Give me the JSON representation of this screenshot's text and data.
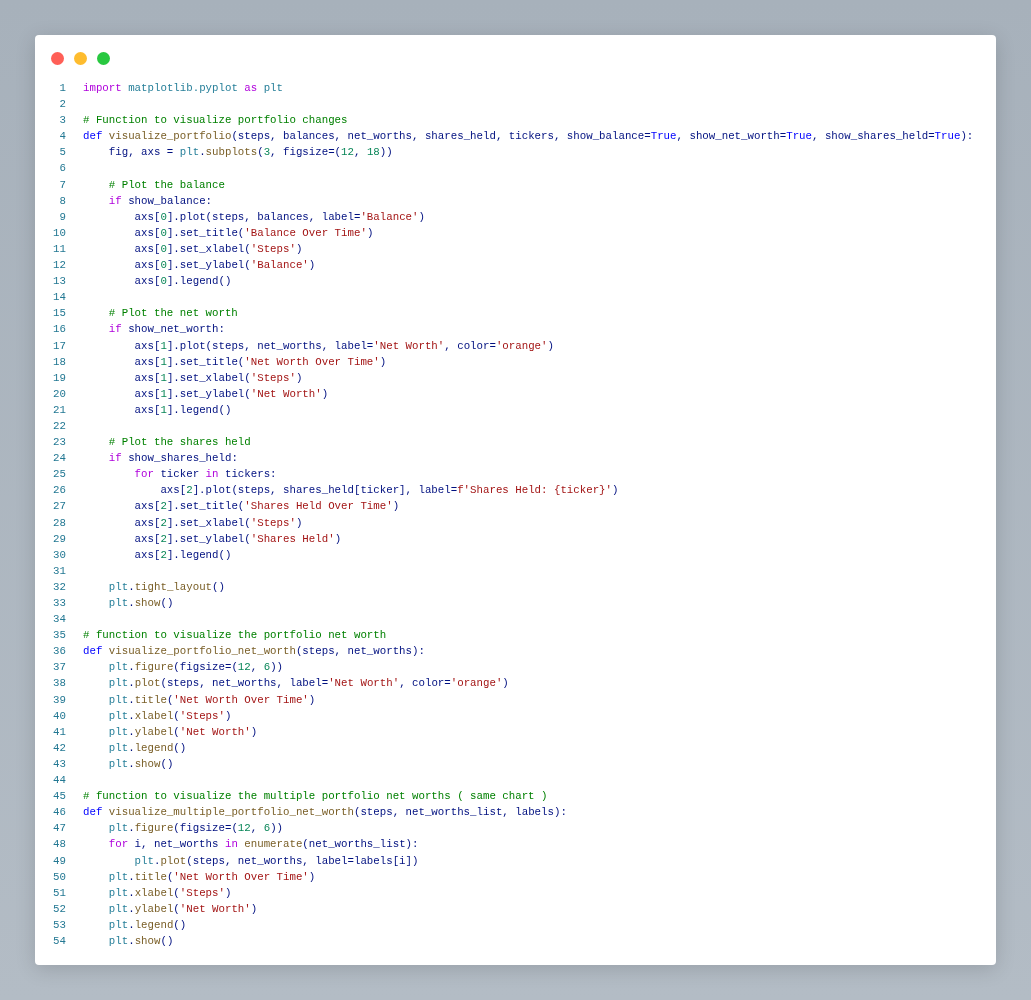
{
  "code": {
    "lines": [
      {
        "number": "1",
        "tokens": [
          {
            "kind": "keyword",
            "text": "import "
          },
          {
            "kind": "module",
            "text": "matplotlib.pyplot "
          },
          {
            "kind": "keyword",
            "text": "as "
          },
          {
            "kind": "module",
            "text": "plt"
          }
        ]
      },
      {
        "number": "2"
      },
      {
        "number": "3",
        "tokens": [
          {
            "kind": "comment",
            "text": "# Function to visualize portfolio changes"
          }
        ]
      },
      {
        "number": "4",
        "tokens": [
          {
            "kind": "def",
            "text": "def "
          },
          {
            "kind": "function",
            "text": "visualize_portfolio"
          },
          {
            "kind": "name",
            "text": "(steps, balances, net_worths, shares_held, tickers, show_balance="
          },
          {
            "kind": "constant",
            "text": "True"
          },
          {
            "kind": "name",
            "text": ", show_net_worth="
          },
          {
            "kind": "constant",
            "text": "True"
          },
          {
            "kind": "name",
            "text": ", show_shares_held="
          },
          {
            "kind": "constant",
            "text": "True"
          },
          {
            "kind": "name",
            "text": "):"
          }
        ]
      },
      {
        "number": "5",
        "tokens": [
          {
            "kind": "name",
            "text": "    fig, axs = "
          },
          {
            "kind": "module",
            "text": "plt"
          },
          {
            "kind": "name",
            "text": "."
          },
          {
            "kind": "function",
            "text": "subplots"
          },
          {
            "kind": "name",
            "text": "("
          },
          {
            "kind": "number",
            "text": "3"
          },
          {
            "kind": "name",
            "text": ", figsize=("
          },
          {
            "kind": "number",
            "text": "12"
          },
          {
            "kind": "name",
            "text": ", "
          },
          {
            "kind": "number",
            "text": "18"
          },
          {
            "kind": "name",
            "text": "))"
          }
        ]
      },
      {
        "number": "6"
      },
      {
        "number": "7",
        "tokens": [
          {
            "kind": "comment",
            "text": "    # Plot the balance"
          }
        ]
      },
      {
        "number": "8",
        "tokens": [
          {
            "kind": "keyword",
            "text": "    if "
          },
          {
            "kind": "name",
            "text": "show_balance:"
          }
        ]
      },
      {
        "number": "9",
        "tokens": [
          {
            "kind": "name",
            "text": "        axs["
          },
          {
            "kind": "number",
            "text": "0"
          },
          {
            "kind": "name",
            "text": "].plot(steps, balances, label="
          },
          {
            "kind": "string",
            "text": "'Balance'"
          },
          {
            "kind": "name",
            "text": ")"
          }
        ]
      },
      {
        "number": "10",
        "tokens": [
          {
            "kind": "name",
            "text": "        axs["
          },
          {
            "kind": "number",
            "text": "0"
          },
          {
            "kind": "name",
            "text": "].set_title("
          },
          {
            "kind": "string",
            "text": "'Balance Over Time'"
          },
          {
            "kind": "name",
            "text": ")"
          }
        ]
      },
      {
        "number": "11",
        "tokens": [
          {
            "kind": "name",
            "text": "        axs["
          },
          {
            "kind": "number",
            "text": "0"
          },
          {
            "kind": "name",
            "text": "].set_xlabel("
          },
          {
            "kind": "string",
            "text": "'Steps'"
          },
          {
            "kind": "name",
            "text": ")"
          }
        ]
      },
      {
        "number": "12",
        "tokens": [
          {
            "kind": "name",
            "text": "        axs["
          },
          {
            "kind": "number",
            "text": "0"
          },
          {
            "kind": "name",
            "text": "].set_ylabel("
          },
          {
            "kind": "string",
            "text": "'Balance'"
          },
          {
            "kind": "name",
            "text": ")"
          }
        ]
      },
      {
        "number": "13",
        "tokens": [
          {
            "kind": "name",
            "text": "        axs["
          },
          {
            "kind": "number",
            "text": "0"
          },
          {
            "kind": "name",
            "text": "].legend()"
          }
        ]
      },
      {
        "number": "14"
      },
      {
        "number": "15",
        "tokens": [
          {
            "kind": "comment",
            "text": "    # Plot the net worth"
          }
        ]
      },
      {
        "number": "16",
        "tokens": [
          {
            "kind": "keyword",
            "text": "    if "
          },
          {
            "kind": "name",
            "text": "show_net_worth:"
          }
        ]
      },
      {
        "number": "17",
        "tokens": [
          {
            "kind": "name",
            "text": "        axs["
          },
          {
            "kind": "number",
            "text": "1"
          },
          {
            "kind": "name",
            "text": "].plot(steps, net_worths, label="
          },
          {
            "kind": "string",
            "text": "'Net Worth'"
          },
          {
            "kind": "name",
            "text": ", color="
          },
          {
            "kind": "string",
            "text": "'orange'"
          },
          {
            "kind": "name",
            "text": ")"
          }
        ]
      },
      {
        "number": "18",
        "tokens": [
          {
            "kind": "name",
            "text": "        axs["
          },
          {
            "kind": "number",
            "text": "1"
          },
          {
            "kind": "name",
            "text": "].set_title("
          },
          {
            "kind": "string",
            "text": "'Net Worth Over Time'"
          },
          {
            "kind": "name",
            "text": ")"
          }
        ]
      },
      {
        "number": "19",
        "tokens": [
          {
            "kind": "name",
            "text": "        axs["
          },
          {
            "kind": "number",
            "text": "1"
          },
          {
            "kind": "name",
            "text": "].set_xlabel("
          },
          {
            "kind": "string",
            "text": "'Steps'"
          },
          {
            "kind": "name",
            "text": ")"
          }
        ]
      },
      {
        "number": "20",
        "tokens": [
          {
            "kind": "name",
            "text": "        axs["
          },
          {
            "kind": "number",
            "text": "1"
          },
          {
            "kind": "name",
            "text": "].set_ylabel("
          },
          {
            "kind": "string",
            "text": "'Net Worth'"
          },
          {
            "kind": "name",
            "text": ")"
          }
        ]
      },
      {
        "number": "21",
        "tokens": [
          {
            "kind": "name",
            "text": "        axs["
          },
          {
            "kind": "number",
            "text": "1"
          },
          {
            "kind": "name",
            "text": "].legend()"
          }
        ]
      },
      {
        "number": "22"
      },
      {
        "number": "23",
        "tokens": [
          {
            "kind": "comment",
            "text": "    # Plot the shares held"
          }
        ]
      },
      {
        "number": "24",
        "tokens": [
          {
            "kind": "keyword",
            "text": "    if "
          },
          {
            "kind": "name",
            "text": "show_shares_held:"
          }
        ]
      },
      {
        "number": "25",
        "tokens": [
          {
            "kind": "keyword",
            "text": "        for "
          },
          {
            "kind": "name",
            "text": "ticker "
          },
          {
            "kind": "keyword",
            "text": "in "
          },
          {
            "kind": "name",
            "text": "tickers:"
          }
        ]
      },
      {
        "number": "26",
        "tokens": [
          {
            "kind": "name",
            "text": "            axs["
          },
          {
            "kind": "number",
            "text": "2"
          },
          {
            "kind": "name",
            "text": "].plot(steps, shares_held[ticker], label="
          },
          {
            "kind": "string",
            "text": "f'Shares Held: {ticker}'"
          },
          {
            "kind": "name",
            "text": ")"
          }
        ]
      },
      {
        "number": "27",
        "tokens": [
          {
            "kind": "name",
            "text": "        axs["
          },
          {
            "kind": "number",
            "text": "2"
          },
          {
            "kind": "name",
            "text": "].set_title("
          },
          {
            "kind": "string",
            "text": "'Shares Held Over Time'"
          },
          {
            "kind": "name",
            "text": ")"
          }
        ]
      },
      {
        "number": "28",
        "tokens": [
          {
            "kind": "name",
            "text": "        axs["
          },
          {
            "kind": "number",
            "text": "2"
          },
          {
            "kind": "name",
            "text": "].set_xlabel("
          },
          {
            "kind": "string",
            "text": "'Steps'"
          },
          {
            "kind": "name",
            "text": ")"
          }
        ]
      },
      {
        "number": "29",
        "tokens": [
          {
            "kind": "name",
            "text": "        axs["
          },
          {
            "kind": "number",
            "text": "2"
          },
          {
            "kind": "name",
            "text": "].set_ylabel("
          },
          {
            "kind": "string",
            "text": "'Shares Held'"
          },
          {
            "kind": "name",
            "text": ")"
          }
        ]
      },
      {
        "number": "30",
        "tokens": [
          {
            "kind": "name",
            "text": "        axs["
          },
          {
            "kind": "number",
            "text": "2"
          },
          {
            "kind": "name",
            "text": "].legend()"
          }
        ]
      },
      {
        "number": "31"
      },
      {
        "number": "32",
        "tokens": [
          {
            "kind": "module",
            "text": "    plt"
          },
          {
            "kind": "name",
            "text": "."
          },
          {
            "kind": "function",
            "text": "tight_layout"
          },
          {
            "kind": "name",
            "text": "()"
          }
        ]
      },
      {
        "number": "33",
        "tokens": [
          {
            "kind": "module",
            "text": "    plt"
          },
          {
            "kind": "name",
            "text": "."
          },
          {
            "kind": "function",
            "text": "show"
          },
          {
            "kind": "name",
            "text": "()"
          }
        ]
      },
      {
        "number": "34"
      },
      {
        "number": "35",
        "tokens": [
          {
            "kind": "comment",
            "text": "# function to visualize the portfolio net worth"
          }
        ]
      },
      {
        "number": "36",
        "tokens": [
          {
            "kind": "def",
            "text": "def "
          },
          {
            "kind": "function",
            "text": "visualize_portfolio_net_worth"
          },
          {
            "kind": "name",
            "text": "(steps, net_worths):"
          }
        ]
      },
      {
        "number": "37",
        "tokens": [
          {
            "kind": "module",
            "text": "    plt"
          },
          {
            "kind": "name",
            "text": "."
          },
          {
            "kind": "function",
            "text": "figure"
          },
          {
            "kind": "name",
            "text": "(figsize=("
          },
          {
            "kind": "number",
            "text": "12"
          },
          {
            "kind": "name",
            "text": ", "
          },
          {
            "kind": "number",
            "text": "6"
          },
          {
            "kind": "name",
            "text": "))"
          }
        ]
      },
      {
        "number": "38",
        "tokens": [
          {
            "kind": "module",
            "text": "    plt"
          },
          {
            "kind": "name",
            "text": "."
          },
          {
            "kind": "function",
            "text": "plot"
          },
          {
            "kind": "name",
            "text": "(steps, net_worths, label="
          },
          {
            "kind": "string",
            "text": "'Net Worth'"
          },
          {
            "kind": "name",
            "text": ", color="
          },
          {
            "kind": "string",
            "text": "'orange'"
          },
          {
            "kind": "name",
            "text": ")"
          }
        ]
      },
      {
        "number": "39",
        "tokens": [
          {
            "kind": "module",
            "text": "    plt"
          },
          {
            "kind": "name",
            "text": "."
          },
          {
            "kind": "function",
            "text": "title"
          },
          {
            "kind": "name",
            "text": "("
          },
          {
            "kind": "string",
            "text": "'Net Worth Over Time'"
          },
          {
            "kind": "name",
            "text": ")"
          }
        ]
      },
      {
        "number": "40",
        "tokens": [
          {
            "kind": "module",
            "text": "    plt"
          },
          {
            "kind": "name",
            "text": "."
          },
          {
            "kind": "function",
            "text": "xlabel"
          },
          {
            "kind": "name",
            "text": "("
          },
          {
            "kind": "string",
            "text": "'Steps'"
          },
          {
            "kind": "name",
            "text": ")"
          }
        ]
      },
      {
        "number": "41",
        "tokens": [
          {
            "kind": "module",
            "text": "    plt"
          },
          {
            "kind": "name",
            "text": "."
          },
          {
            "kind": "function",
            "text": "ylabel"
          },
          {
            "kind": "name",
            "text": "("
          },
          {
            "kind": "string",
            "text": "'Net Worth'"
          },
          {
            "kind": "name",
            "text": ")"
          }
        ]
      },
      {
        "number": "42",
        "tokens": [
          {
            "kind": "module",
            "text": "    plt"
          },
          {
            "kind": "name",
            "text": "."
          },
          {
            "kind": "function",
            "text": "legend"
          },
          {
            "kind": "name",
            "text": "()"
          }
        ]
      },
      {
        "number": "43",
        "tokens": [
          {
            "kind": "module",
            "text": "    plt"
          },
          {
            "kind": "name",
            "text": "."
          },
          {
            "kind": "function",
            "text": "show"
          },
          {
            "kind": "name",
            "text": "()"
          }
        ]
      },
      {
        "number": "44"
      },
      {
        "number": "45",
        "tokens": [
          {
            "kind": "comment",
            "text": "# function to visualize the multiple portfolio net worths ( same chart )"
          }
        ]
      },
      {
        "number": "46",
        "tokens": [
          {
            "kind": "def",
            "text": "def "
          },
          {
            "kind": "function",
            "text": "visualize_multiple_portfolio_net_worth"
          },
          {
            "kind": "name",
            "text": "(steps, net_worths_list, labels):"
          }
        ]
      },
      {
        "number": "47",
        "tokens": [
          {
            "kind": "module",
            "text": "    plt"
          },
          {
            "kind": "name",
            "text": "."
          },
          {
            "kind": "function",
            "text": "figure"
          },
          {
            "kind": "name",
            "text": "(figsize=("
          },
          {
            "kind": "number",
            "text": "12"
          },
          {
            "kind": "name",
            "text": ", "
          },
          {
            "kind": "number",
            "text": "6"
          },
          {
            "kind": "name",
            "text": "))"
          }
        ]
      },
      {
        "number": "48",
        "tokens": [
          {
            "kind": "keyword",
            "text": "    for "
          },
          {
            "kind": "name",
            "text": "i, net_worths "
          },
          {
            "kind": "keyword",
            "text": "in "
          },
          {
            "kind": "function",
            "text": "enumerate"
          },
          {
            "kind": "name",
            "text": "(net_worths_list):"
          }
        ]
      },
      {
        "number": "49",
        "tokens": [
          {
            "kind": "module",
            "text": "        plt"
          },
          {
            "kind": "name",
            "text": "."
          },
          {
            "kind": "function",
            "text": "plot"
          },
          {
            "kind": "name",
            "text": "(steps, net_worths, label=labels[i])"
          }
        ]
      },
      {
        "number": "50",
        "tokens": [
          {
            "kind": "module",
            "text": "    plt"
          },
          {
            "kind": "name",
            "text": "."
          },
          {
            "kind": "function",
            "text": "title"
          },
          {
            "kind": "name",
            "text": "("
          },
          {
            "kind": "string",
            "text": "'Net Worth Over Time'"
          },
          {
            "kind": "name",
            "text": ")"
          }
        ]
      },
      {
        "number": "51",
        "tokens": [
          {
            "kind": "module",
            "text": "    plt"
          },
          {
            "kind": "name",
            "text": "."
          },
          {
            "kind": "function",
            "text": "xlabel"
          },
          {
            "kind": "name",
            "text": "("
          },
          {
            "kind": "string",
            "text": "'Steps'"
          },
          {
            "kind": "name",
            "text": ")"
          }
        ]
      },
      {
        "number": "52",
        "tokens": [
          {
            "kind": "module",
            "text": "    plt"
          },
          {
            "kind": "name",
            "text": "."
          },
          {
            "kind": "function",
            "text": "ylabel"
          },
          {
            "kind": "name",
            "text": "("
          },
          {
            "kind": "string",
            "text": "'Net Worth'"
          },
          {
            "kind": "name",
            "text": ")"
          }
        ]
      },
      {
        "number": "53",
        "tokens": [
          {
            "kind": "module",
            "text": "    plt"
          },
          {
            "kind": "name",
            "text": "."
          },
          {
            "kind": "function",
            "text": "legend"
          },
          {
            "kind": "name",
            "text": "()"
          }
        ]
      },
      {
        "number": "54",
        "tokens": [
          {
            "kind": "module",
            "text": "    plt"
          },
          {
            "kind": "name",
            "text": "."
          },
          {
            "kind": "function",
            "text": "show"
          },
          {
            "kind": "name",
            "text": "()"
          }
        ]
      }
    ]
  }
}
